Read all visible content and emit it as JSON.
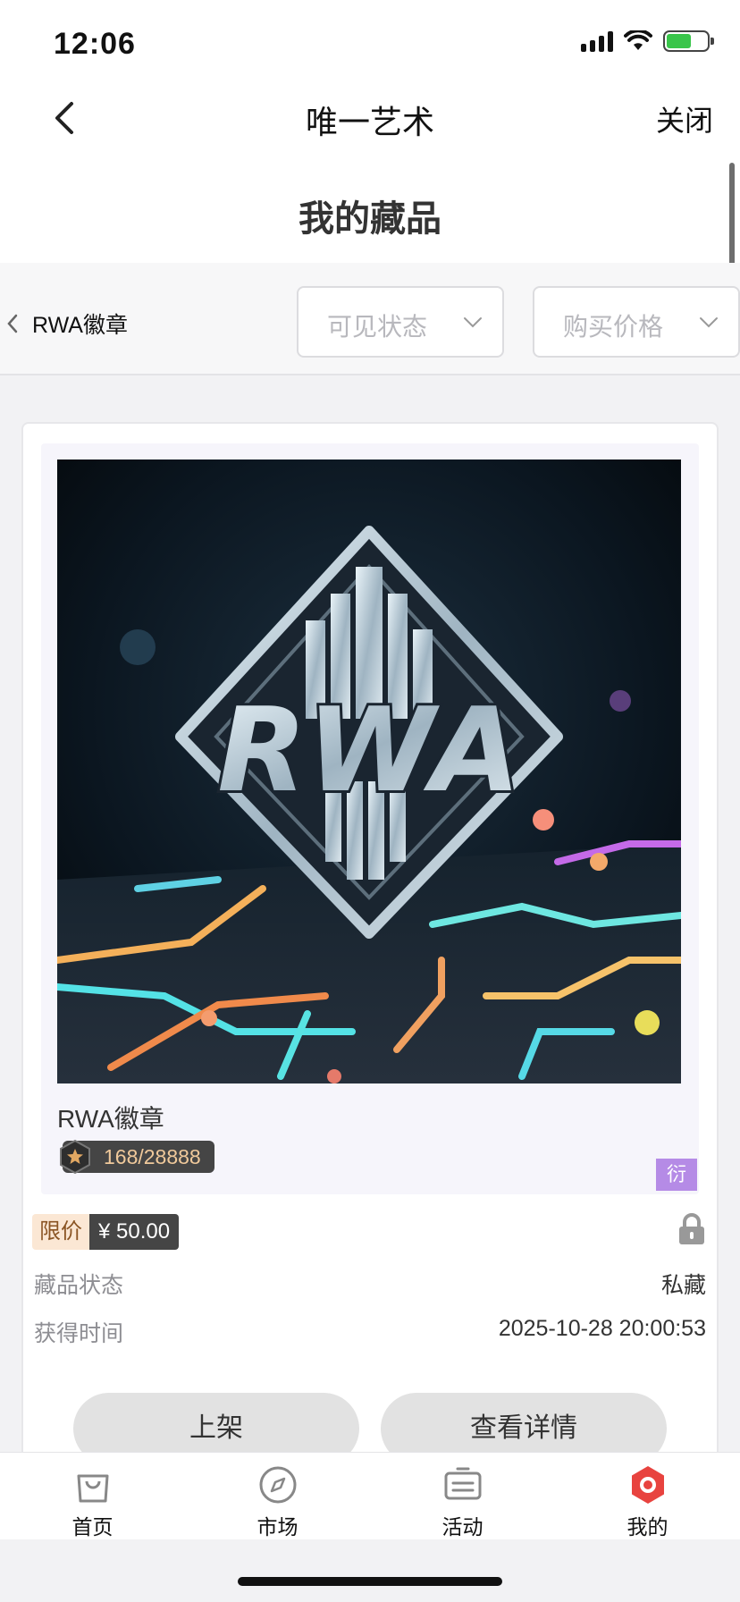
{
  "status_bar": {
    "time": "12:06"
  },
  "nav": {
    "title": "唯一艺术",
    "close_label": "关闭"
  },
  "page": {
    "title": "我的藏品"
  },
  "filter": {
    "back_label": "RWA徽章",
    "visibility_placeholder": "可见状态",
    "price_placeholder": "购买价格"
  },
  "item": {
    "name": "RWA徽章",
    "art_text": "RWA",
    "serial": "168/28888",
    "corner_tag": "衍",
    "price_label": "限价",
    "price_value": "¥ 50.00",
    "status_label": "藏品状态",
    "status_value": "私藏",
    "time_label": "获得时间",
    "time_value": "2025-10-28 20:00:53",
    "list_button": "上架",
    "detail_button": "查看详情"
  },
  "tabs": [
    {
      "label": "首页",
      "icon": "bag-icon"
    },
    {
      "label": "市场",
      "icon": "compass-icon"
    },
    {
      "label": "活动",
      "icon": "ticket-icon"
    },
    {
      "label": "我的",
      "icon": "profile-hex-icon",
      "active": true
    }
  ],
  "colors": {
    "accent_red": "#e8433f",
    "serial_gold": "#f0c99b",
    "price_tag_bg": "#fbe7d4",
    "corner_tag_purple": "#b58be6",
    "battery_green": "#39c54a"
  }
}
